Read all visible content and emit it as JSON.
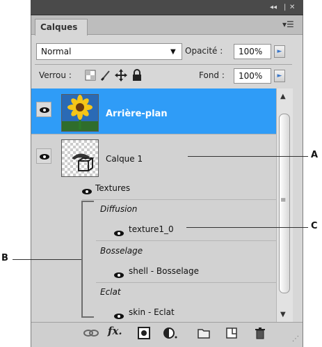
{
  "panel": {
    "tab_label": "Calques",
    "menu_icon": "panel-menu-icon"
  },
  "controls": {
    "blend_mode": "Normal",
    "opacity_label": "Opacité :",
    "opacity_value": "100%",
    "lock_label": "Verrou :",
    "fill_label": "Fond :",
    "fill_value": "100%"
  },
  "layers": [
    {
      "name": "Arrière-plan",
      "selected": true,
      "thumb": "sunflower-thumbnail"
    },
    {
      "name": "Calque 1",
      "selected": false,
      "thumb": "transparent-3d-thumbnail"
    }
  ],
  "effects": {
    "header": "Textures",
    "groups": [
      {
        "group": "Diffusion",
        "item": "texture1_0"
      },
      {
        "group": "Bosselage",
        "item": "shell - Bosselage"
      },
      {
        "group": "Eclat",
        "item": "skin - Eclat"
      }
    ]
  },
  "callouts": {
    "a": "A",
    "b": "B",
    "c": "C"
  },
  "colors": {
    "selection": "#2f9cf7",
    "titlebar": "#4a4a4a",
    "accent_arrow": "#3a77c9"
  }
}
